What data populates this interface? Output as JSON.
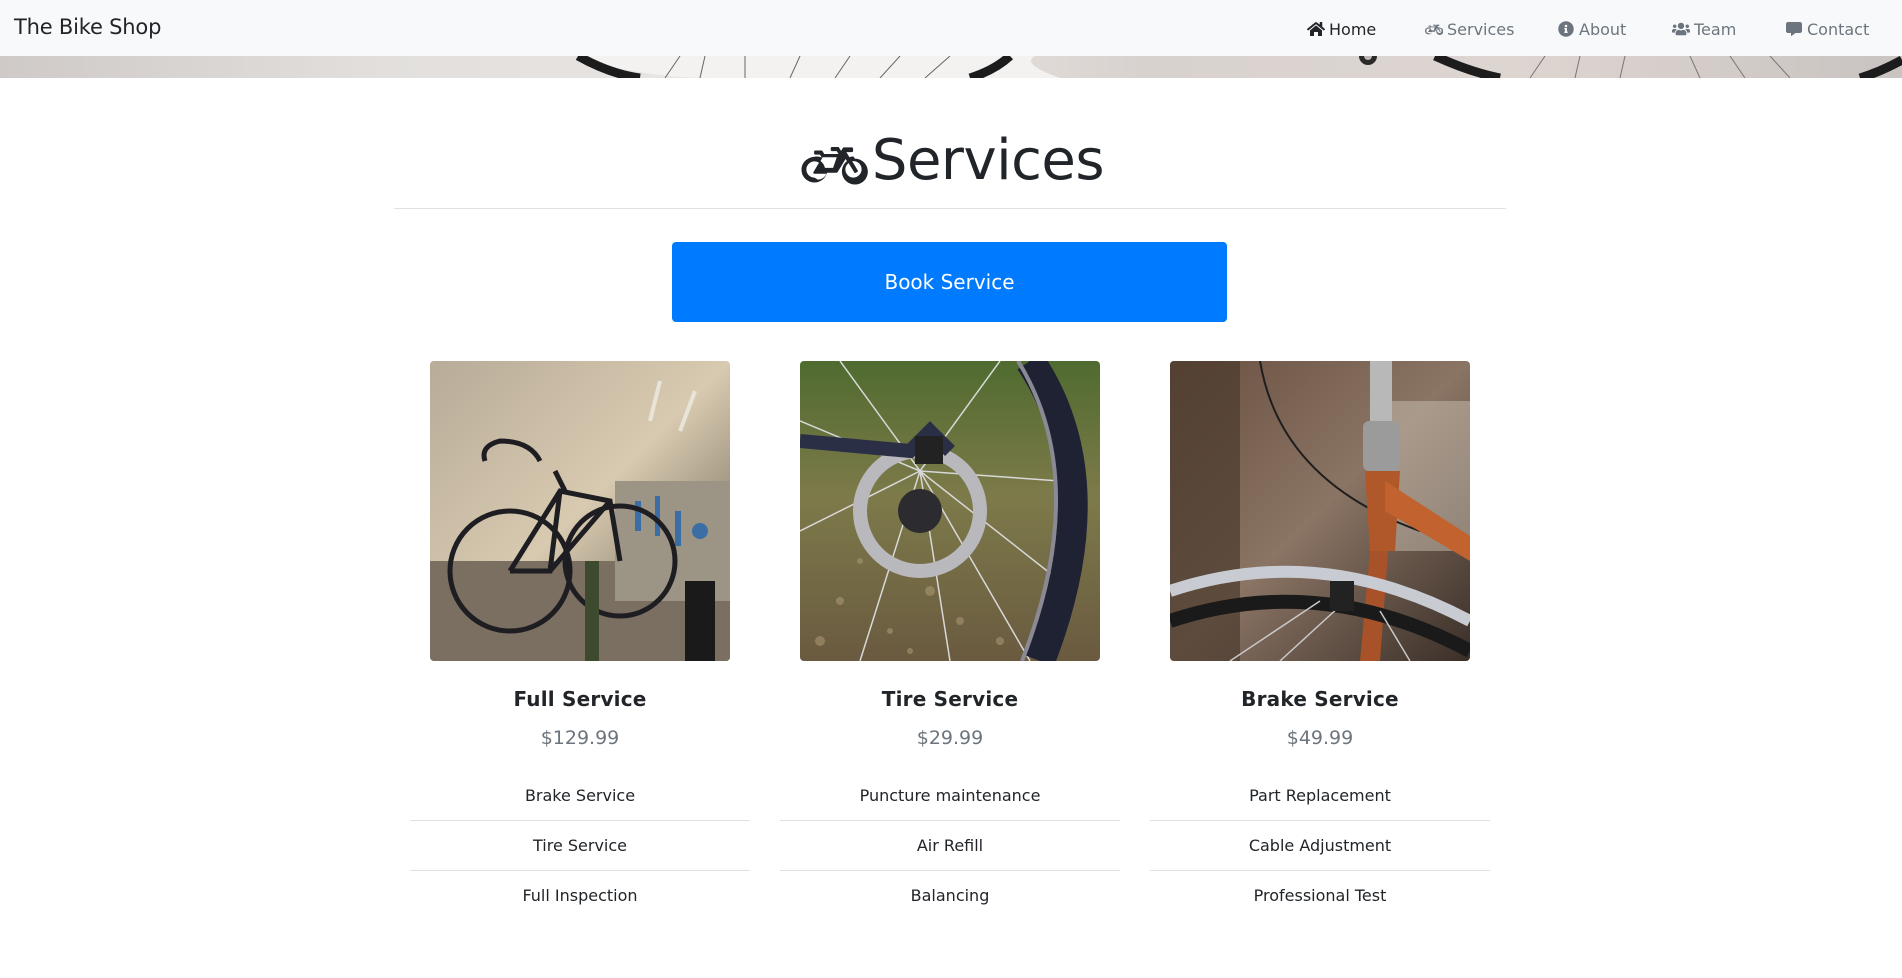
{
  "navbar": {
    "brand": "The Bike Shop",
    "items": [
      {
        "label": "Home",
        "icon": "home-icon",
        "active": true
      },
      {
        "label": "Services",
        "icon": "bicycle-icon",
        "active": false
      },
      {
        "label": "About",
        "icon": "info-circle-icon",
        "active": false
      },
      {
        "label": "Team",
        "icon": "users-icon",
        "active": false
      },
      {
        "label": "Contact",
        "icon": "comment-icon",
        "active": false
      }
    ]
  },
  "page": {
    "title": "Services",
    "title_icon": "bicycle-icon",
    "book_button": "Book Service"
  },
  "services": [
    {
      "name": "Full Service",
      "price": "$129.99",
      "image": "bike-on-workstand-photo",
      "features": [
        "Brake Service",
        "Tire Service",
        "Full Inspection"
      ]
    },
    {
      "name": "Tire Service",
      "price": "$29.99",
      "image": "rear-wheel-disc-brake-photo",
      "features": [
        "Puncture maintenance",
        "Air Refill",
        "Balancing"
      ]
    },
    {
      "name": "Brake Service",
      "price": "$49.99",
      "image": "orange-fork-brake-photo",
      "features": [
        "Part Replacement",
        "Cable Adjustment",
        "Professional Test"
      ]
    }
  ],
  "colors": {
    "primary": "#007bff",
    "navbar_bg": "#f8f9fa",
    "muted_text": "#6c757d",
    "text": "#212529",
    "divider": "#dee2e6"
  }
}
